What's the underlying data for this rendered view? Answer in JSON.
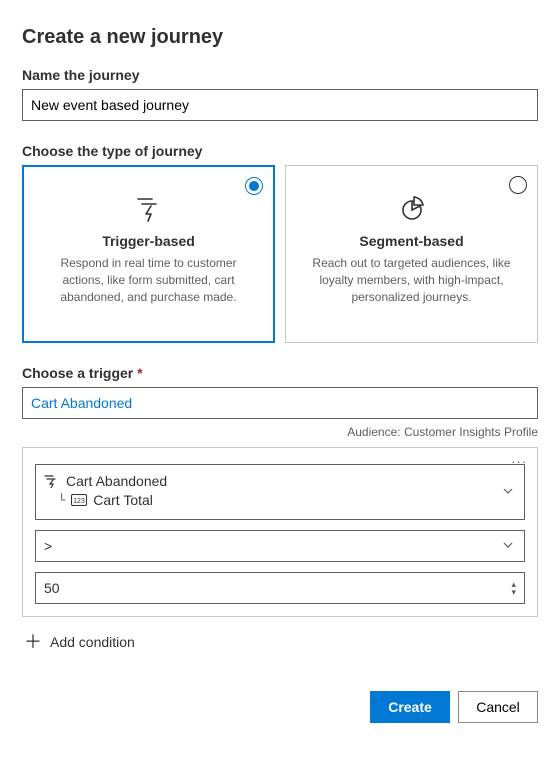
{
  "page_title": "Create a new journey",
  "name_section": {
    "label": "Name the journey",
    "value": "New event based journey"
  },
  "type_section": {
    "label": "Choose the type of journey",
    "trigger": {
      "title": "Trigger-based",
      "desc": "Respond in real time to customer actions, like form submitted, cart abandoned, and purchase made."
    },
    "segment": {
      "title": "Segment-based",
      "desc": "Reach out to targeted audiences, like loyalty members, with high-impact, personalized journeys."
    }
  },
  "trigger_section": {
    "label": "Choose a trigger ",
    "required_mark": "*",
    "value": "Cart Abandoned",
    "audience_prefix": "Audience: ",
    "audience_value": "Customer Insights Profile"
  },
  "condition": {
    "attribute_root": "Cart Abandoned",
    "attribute_field": "Cart Total",
    "operator": ">",
    "value": "50"
  },
  "add_condition_label": "Add condition",
  "footer": {
    "create": "Create",
    "cancel": "Cancel"
  }
}
